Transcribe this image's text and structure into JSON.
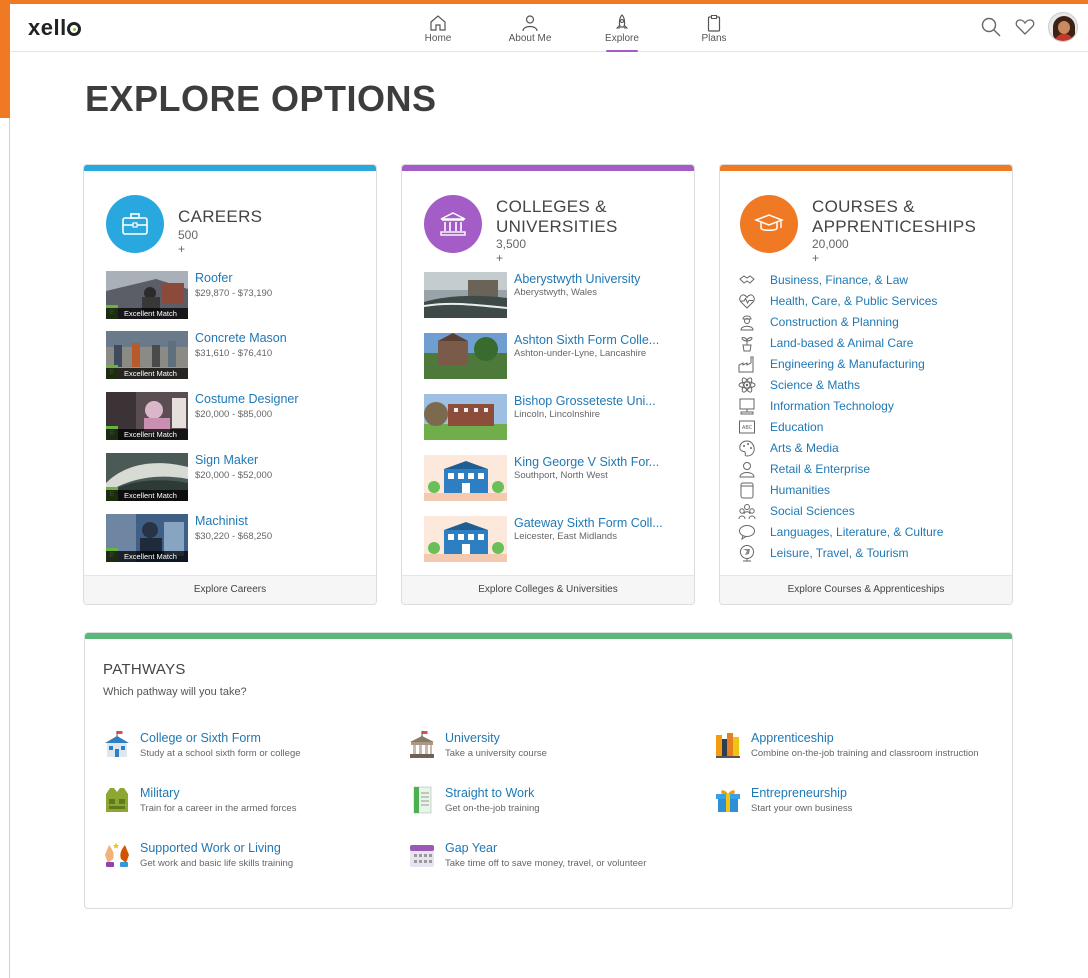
{
  "app": {
    "logo_text": "xello"
  },
  "nav": {
    "items": [
      {
        "label": "Home",
        "icon": "home-icon"
      },
      {
        "label": "About Me",
        "icon": "person-icon"
      },
      {
        "label": "Explore",
        "icon": "rocket-icon",
        "active": true
      },
      {
        "label": "Plans",
        "icon": "clipboard-icon"
      }
    ]
  },
  "header_right": {
    "icons": [
      "search-icon",
      "heart-icon",
      "avatar"
    ]
  },
  "page": {
    "title": "EXPLORE OPTIONS"
  },
  "careers": {
    "title": "CAREERS",
    "count": "500 +",
    "accent": "#29a8df",
    "footer": "Explore Careers",
    "badge_letter": "E",
    "badge_text": "Excellent Match",
    "items": [
      {
        "title": "Roofer",
        "salary": "$29,870 - $73,190"
      },
      {
        "title": "Concrete Mason",
        "salary": "$31,610 - $76,410"
      },
      {
        "title": "Costume Designer",
        "salary": "$20,000 - $85,000"
      },
      {
        "title": "Sign Maker",
        "salary": "$20,000 - $52,000"
      },
      {
        "title": "Machinist",
        "salary": "$30,220 - $68,250"
      }
    ]
  },
  "colleges": {
    "title_line1": "COLLEGES &",
    "title_line2": "UNIVERSITIES",
    "count": "3,500 +",
    "accent": "#a45cc7",
    "footer": "Explore Colleges & Universities",
    "items": [
      {
        "name": "Aberystwyth University",
        "location": "Aberystwyth, Wales"
      },
      {
        "name": "Ashton Sixth Form Colle...",
        "location": "Ashton-under-Lyne, Lancashire"
      },
      {
        "name": "Bishop Grosseteste Uni...",
        "location": "Lincoln, Lincolnshire"
      },
      {
        "name": "King George V Sixth For...",
        "location": "Southport, North West"
      },
      {
        "name": "Gateway Sixth Form Coll...",
        "location": "Leicester, East Midlands"
      }
    ]
  },
  "courses": {
    "title_line1": "COURSES &",
    "title_line2": "APPRENTICESHIPS",
    "count": "20,000 +",
    "accent": "#f07a24",
    "footer": "Explore Courses & Apprenticeships",
    "items": [
      {
        "label": "Business, Finance, & Law",
        "icon": "handshake-icon"
      },
      {
        "label": "Health, Care, & Public Services",
        "icon": "heartbeat-icon"
      },
      {
        "label": "Construction & Planning",
        "icon": "worker-icon"
      },
      {
        "label": "Land-based & Animal Care",
        "icon": "plant-icon"
      },
      {
        "label": "Engineering & Manufacturing",
        "icon": "factory-icon"
      },
      {
        "label": "Science & Maths",
        "icon": "atom-icon"
      },
      {
        "label": "Information Technology",
        "icon": "computer-icon"
      },
      {
        "label": "Education",
        "icon": "chalkboard-icon"
      },
      {
        "label": "Arts & Media",
        "icon": "palette-icon"
      },
      {
        "label": "Retail & Enterprise",
        "icon": "salesperson-icon"
      },
      {
        "label": "Humanities",
        "icon": "scroll-icon"
      },
      {
        "label": "Social Sciences",
        "icon": "people-icon"
      },
      {
        "label": "Languages, Literature, & Culture",
        "icon": "speech-icon"
      },
      {
        "label": "Leisure, Travel, & Tourism",
        "icon": "globe-icon"
      }
    ]
  },
  "pathways": {
    "title": "PATHWAYS",
    "subtitle": "Which pathway will you take?",
    "accent": "#5cb87a",
    "items": [
      {
        "title": "College or Sixth Form",
        "desc": "Study at a school sixth form or college",
        "icon": "school-icon"
      },
      {
        "title": "University",
        "desc": "Take a university course",
        "icon": "university-icon"
      },
      {
        "title": "Apprenticeship",
        "desc": "Combine on-the-job training and classroom instruction",
        "icon": "books-icon"
      },
      {
        "title": "Military",
        "desc": "Train for a career in the armed forces",
        "icon": "vest-icon"
      },
      {
        "title": "Straight to Work",
        "desc": "Get on-the-job training",
        "icon": "document-icon"
      },
      {
        "title": "Entrepreneurship",
        "desc": "Start your own business",
        "icon": "gift-icon"
      },
      {
        "title": "Supported Work or Living",
        "desc": "Get work and basic life skills training",
        "icon": "helping-hands-icon"
      },
      {
        "title": "Gap Year",
        "desc": "Take time off to save money, travel, or volunteer",
        "icon": "calendar-icon"
      }
    ]
  }
}
